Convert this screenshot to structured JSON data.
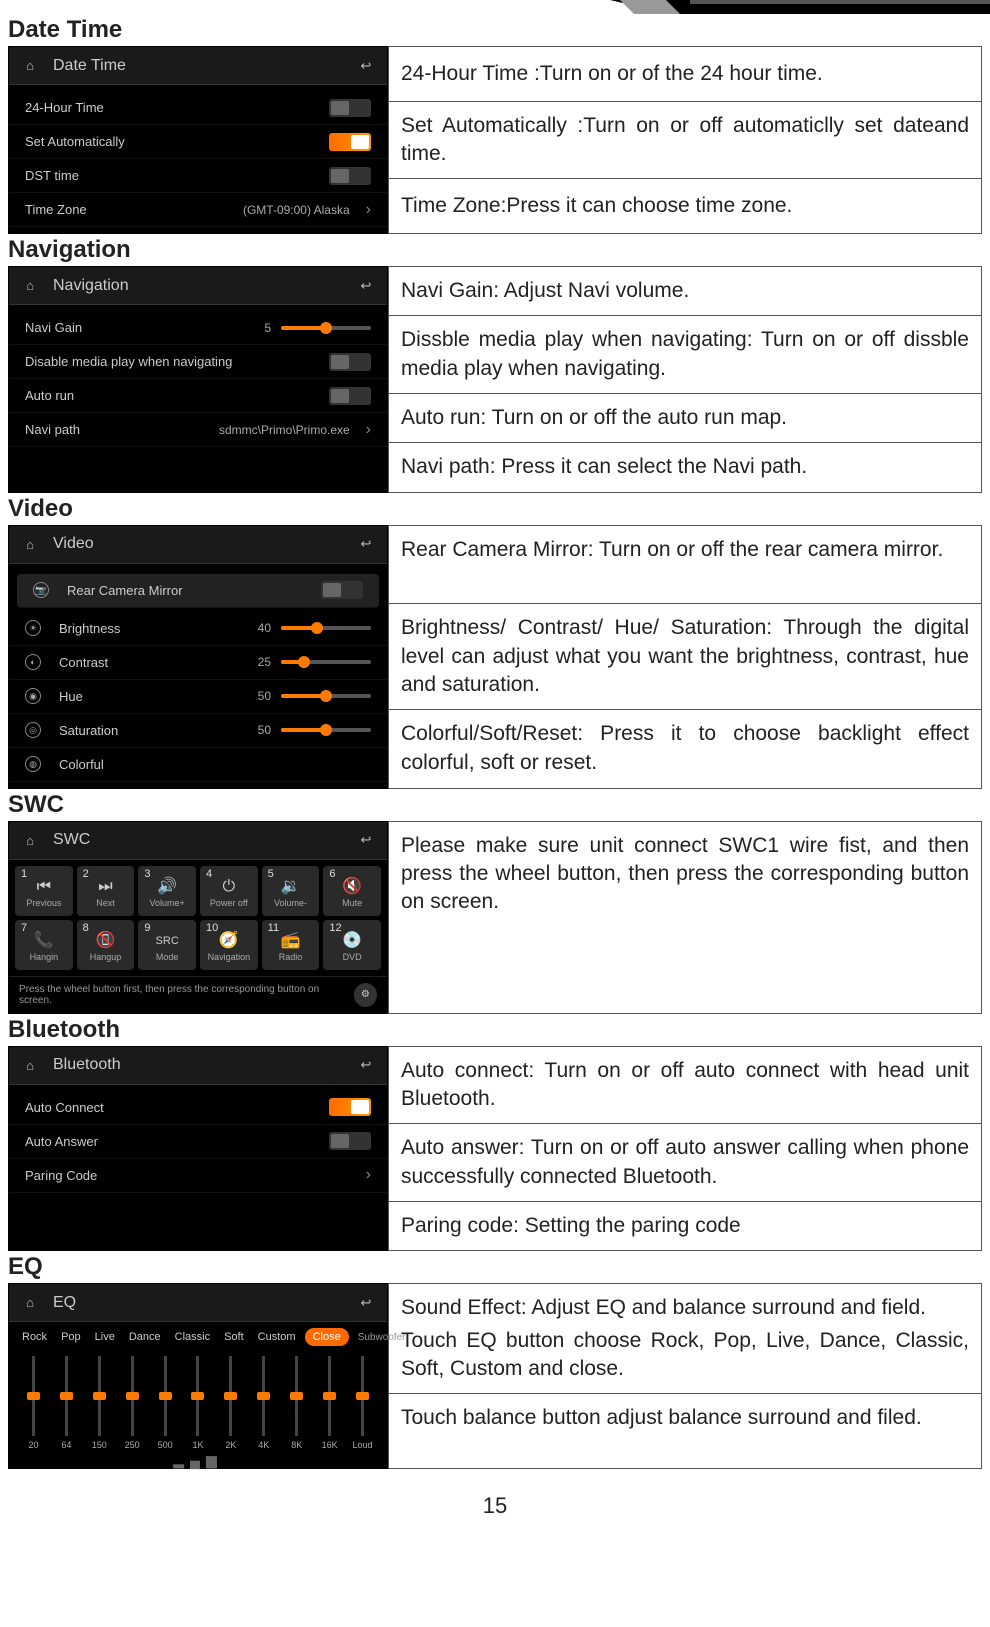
{
  "page_number": "15",
  "sections": {
    "date_time": {
      "title": "Date Time",
      "screenshot_title": "Date   Time",
      "rows": {
        "r1": "24-Hour Time",
        "r2": "Set Automatically",
        "r3": "DST time",
        "r4": "Time Zone",
        "r4_value": "(GMT-09:00) Alaska"
      },
      "desc": [
        "24-Hour Time :Turn on or of the 24 hour time.",
        "Set Automatically :Turn on or off automaticlly set dateand time.",
        "Time Zone:Press it can choose time zone."
      ]
    },
    "navigation": {
      "title": "Navigation",
      "screenshot_title": "Navigation",
      "rows": {
        "r1": "Navi Gain",
        "r1_value": "5",
        "r2": "Disable media play when navigating",
        "r3": "Auto run",
        "r4": "Navi path",
        "r4_value": "sdmmc\\Primo\\Primo.exe"
      },
      "desc": [
        "Navi Gain: Adjust Navi volume.",
        "Dissble media play when navigating: Turn on or off dissble media play when navigating.",
        "Auto run: Turn on or off the auto run map.",
        "Navi path: Press it can select the Navi path."
      ]
    },
    "video": {
      "title": "Video",
      "screenshot_title": "Video",
      "rows": {
        "rear": "Rear Camera Mirror",
        "brightness": "Brightness",
        "brightness_v": "40",
        "contrast": "Contrast",
        "contrast_v": "25",
        "hue": "Hue",
        "hue_v": "50",
        "saturation": "Saturation",
        "saturation_v": "50",
        "colorful": "Colorful"
      },
      "desc": [
        "Rear Camera Mirror: Turn on or off the rear camera mirror.",
        "Brightness/ Contrast/ Hue/ Saturation: Through the digital level can adjust what you want the brightness, contrast, hue and saturation.",
        "Colorful/Soft/Reset: Press it to choose backlight effect colorful, soft or reset."
      ]
    },
    "swc": {
      "title": "SWC",
      "screenshot_title": "SWC",
      "buttons": [
        {
          "n": "1",
          "t": "Previous",
          "i": "⏮"
        },
        {
          "n": "2",
          "t": "Next",
          "i": "⏭"
        },
        {
          "n": "3",
          "t": "Volume+",
          "i": "🔊"
        },
        {
          "n": "4",
          "t": "Power off",
          "i": "⏻"
        },
        {
          "n": "5",
          "t": "Volume-",
          "i": "🔉"
        },
        {
          "n": "6",
          "t": "Mute",
          "i": "🔇"
        },
        {
          "n": "7",
          "t": "Hangin",
          "i": "📞"
        },
        {
          "n": "8",
          "t": "Hangup",
          "i": "📵"
        },
        {
          "n": "9",
          "t": "Mode",
          "i": "SRC"
        },
        {
          "n": "10",
          "t": "Navigation",
          "i": "🧭"
        },
        {
          "n": "11",
          "t": "Radio",
          "i": "📻"
        },
        {
          "n": "12",
          "t": "DVD",
          "i": "💿"
        }
      ],
      "hint": "Press the wheel button first, then press the corresponding button on screen.",
      "desc": [
        "Please make sure unit connect SWC1 wire fist, and then press the wheel button, then press the corresponding button on screen."
      ]
    },
    "bluetooth": {
      "title": "Bluetooth",
      "screenshot_title": "Bluetooth",
      "rows": {
        "r1": "Auto Connect",
        "r2": "Auto Answer",
        "r3": "Paring Code"
      },
      "desc": [
        "Auto connect: Turn on or off auto connect with head unit Bluetooth.",
        "Auto answer: Turn on or off auto answer calling when phone successfully connected Bluetooth.",
        "Paring code: Setting the paring code"
      ]
    },
    "eq": {
      "title": "EQ",
      "screenshot_title": "EQ",
      "presets": [
        "Rock",
        "Pop",
        "Live",
        "Dance",
        "Classic",
        "Soft",
        "Custom"
      ],
      "close": "Close",
      "subwoofer": "Subwoofer",
      "bands": [
        "20",
        "64",
        "150",
        "250",
        "500",
        "1K",
        "2K",
        "4K",
        "8K",
        "16K",
        "Loud"
      ],
      "desc_a": "Sound Effect: Adjust EQ and balance surround and field.",
      "desc_b": "Touch EQ button choose Rock, Pop, Live, Dance, Classic, Soft, Custom and close.",
      "desc_c": "Touch balance button adjust balance surround and filed."
    }
  }
}
